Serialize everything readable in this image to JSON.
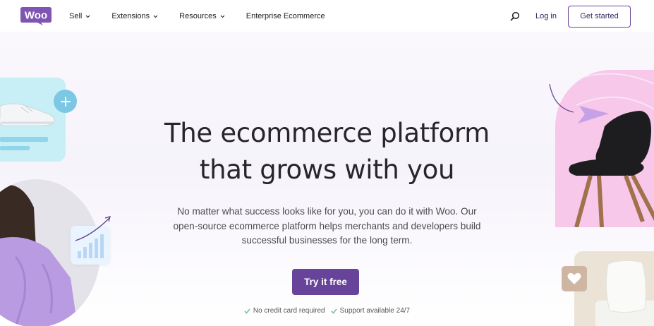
{
  "brand": {
    "logo_text": "Woo",
    "color": "#7f54b3"
  },
  "nav": {
    "items": [
      {
        "label": "Sell",
        "has_dropdown": true
      },
      {
        "label": "Extensions",
        "has_dropdown": true
      },
      {
        "label": "Resources",
        "has_dropdown": true
      },
      {
        "label": "Enterprise Ecommerce",
        "has_dropdown": false
      }
    ],
    "search_icon": "search-icon",
    "login_label": "Log in",
    "get_started_label": "Get started"
  },
  "hero": {
    "headline_line1": "The ecommerce platform",
    "headline_line2": "that grows with you",
    "subtext_line1": "No matter what success looks like for you, you can do it with Woo. Our",
    "subtext_line2": "open-source ecommerce platform helps merchants and developers build",
    "subtext_line3": "successful businesses for the long term.",
    "cta_label": "Try it free",
    "features": [
      "No credit card required",
      "Support available 24/7"
    ]
  },
  "colors": {
    "primary": "#674399",
    "check": "#6ec6a6",
    "text_dark": "#272729",
    "text_muted": "#4a4a4f"
  }
}
